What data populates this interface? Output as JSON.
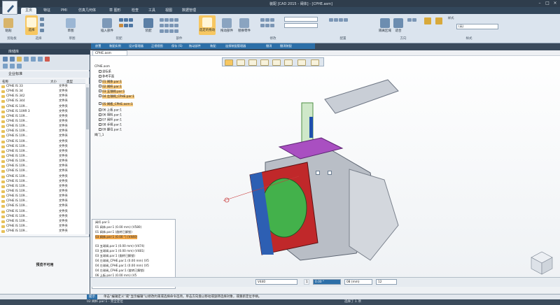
{
  "titlebar": {
    "title": "装配 [CAD 2015 - 阀体] - [CPHE.asm]"
  },
  "tabs": [
    "主页",
    "特征",
    "PMI",
    "仿真几何体",
    "草 图形",
    "检查",
    "工具",
    "视图",
    "数据管理"
  ],
  "ribbon": {
    "buttons": [
      {
        "label": "粘贴"
      },
      {
        "label": "选择"
      },
      {
        "label": "草图"
      },
      {
        "label": "插入部件"
      },
      {
        "label": "装配"
      },
      {
        "label": "选定的拖动"
      },
      {
        "label": "拖动部件"
      },
      {
        "label": "替换零件"
      },
      {
        "label": "隔离区域"
      },
      {
        "label": "适合"
      }
    ],
    "groups": [
      "剪贴板",
      "选择",
      "草图",
      "装配",
      "部件",
      "修改",
      "配置",
      "方向",
      "样式"
    ],
    "style_label": "样式",
    "style_value": "(无)"
  },
  "quickbar": [
    "放置",
    "装配实例",
    "设计管理器",
    "正视视图",
    "保存 (S)",
    "拖动部件",
    "装配",
    "连接装配管理器",
    "撤消",
    "撤消装配"
  ],
  "left_panel": {
    "title": "库储库",
    "folder": "企业标准",
    "columns": {
      "name": "名称",
      "size": "大小",
      "type": "类型"
    },
    "files": [
      {
        "name": "CPHE IS 33",
        "type": "文件夹"
      },
      {
        "name": "CPHE IS 34",
        "type": "文件夹"
      },
      {
        "name": "CPHE IS 342",
        "type": "文件夹"
      },
      {
        "name": "CPHE IS 344",
        "type": "文件夹"
      },
      {
        "name": "CPHE IS 109...",
        "type": "文件夹"
      },
      {
        "name": "CPHE IS 109R 3",
        "type": "文件夹"
      },
      {
        "name": "CPHE IS 109...",
        "type": "文件夹"
      },
      {
        "name": "CPHE IS 109...",
        "type": "文件夹"
      },
      {
        "name": "CPHE IS 109...",
        "type": "文件夹"
      },
      {
        "name": "CPHE IS 109...",
        "type": "文件夹"
      },
      {
        "name": "CPHE IS 109...",
        "type": "文件夹"
      },
      {
        "name": "CPHE IS 109...",
        "type": "文件夹"
      },
      {
        "name": "CPHE IS 109...",
        "type": "文件夹"
      },
      {
        "name": "CPHE IS 109...",
        "type": "文件夹"
      },
      {
        "name": "CPHE IS 109...",
        "type": "文件夹"
      },
      {
        "name": "CPHE IS 109...",
        "type": "文件夹"
      },
      {
        "name": "CPHE IS 109...",
        "type": "文件夹"
      },
      {
        "name": "CPHE IS 109...",
        "type": "文件夹"
      },
      {
        "name": "CPHE IS 109...",
        "type": "文件夹"
      },
      {
        "name": "CPHE IS 109...",
        "type": "文件夹"
      },
      {
        "name": "CPHE IS 109...",
        "type": "文件夹"
      },
      {
        "name": "CPHE IS 109...",
        "type": "文件夹"
      },
      {
        "name": "CPHE IS 109...",
        "type": "文件夹"
      },
      {
        "name": "CPHE IS 109...",
        "type": "文件夹"
      },
      {
        "name": "CPHE IS 109...",
        "type": "文件夹"
      },
      {
        "name": "CPHE IS 109...",
        "type": "文件夹"
      },
      {
        "name": "CPHE IS 109...",
        "type": "文件夹"
      },
      {
        "name": "CPHE IS 109...",
        "type": "文件夹"
      },
      {
        "name": "CPHE IS 109...",
        "type": "文件夹"
      },
      {
        "name": "CPHE IS 109...",
        "type": "文件夹"
      }
    ],
    "preview_message": "预览不可用"
  },
  "view": {
    "doc_tab": "CPHE.asm",
    "tree": [
      "CPHE.asm",
      "坐标系",
      "参考平面",
      "01 阀体.par:1",
      "02 阀杆.par:1",
      "03 五球阀.par:1",
      "04 左球阀_CPHE.par:1",
      "05 阀板_CPHE.asm:1",
      "06 上板.par:1",
      "06 填料.par:1",
      "07 阀杆.par:1",
      "08 手柄.par:1",
      "09 螺母.par:1",
      "阀门_1"
    ],
    "pathfinder": [
      "阀杆.par:1",
      "01 阀体.par:1   (0.00 mm)   (V580)",
      "01 阀体.par:1   (旋转已解锁)",
      "03 阀体.par:1   (0.00 °)   (V440)",
      "03 五球阀.par:1   (0.00 mm)   (V474)",
      "03 五球阀.par:1   (0.00 mm)   (V481)",
      "03 五球阀.par:1   (旋转已解锁)",
      "04 左球阀_CPHE.par:1   (0.00 mm)   (V5",
      "04 左球阀_CPHE.par:1   (0.00 mm)   (V5",
      "04 左球阀_CPHE.par:1   (旋转已解锁)",
      "06 上板.par:1   (0.00 mm)   (V5",
      "01 阀体.par:1   (0.00 mm)   (V589)",
      "07 阀杆.par:1   (旋转已解锁)"
    ],
    "bottom_fields": {
      "v1": "V440",
      "v2": "1",
      "v3": "0.00 °",
      "v4": "08 (mm)",
      "v5": "12"
    }
  },
  "prompt": {
    "label": "提示",
    "text": "单击“编辑定义”或“显示编辑”以修改约束或选择命令选项。单击方向盘以移动或旋转选择对象，或重新定位手柄。"
  },
  "status": {
    "left": "02 阀杆.par:1 - 完全定位",
    "right": "选择了 1 项"
  },
  "colors": {
    "accent": "#2c6fa8",
    "highlight": "#f3a94b",
    "part_red": "#c0282a",
    "part_green": "#43b14b",
    "part_purple": "#a94fc1"
  }
}
